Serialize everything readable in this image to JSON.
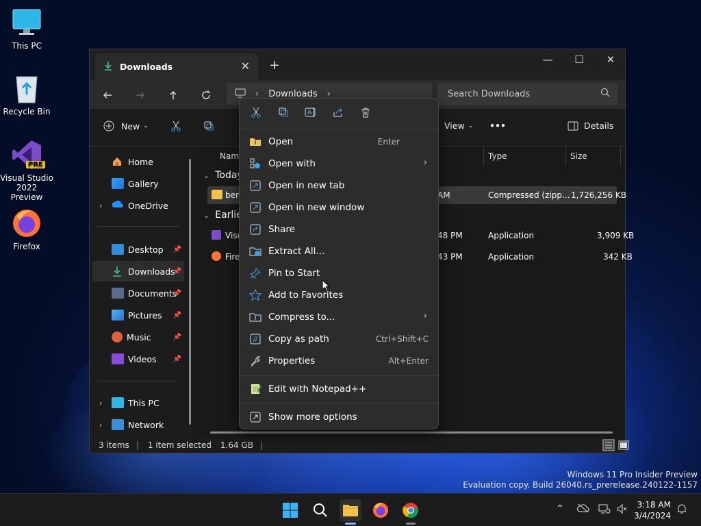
{
  "desktop": {
    "icons": [
      {
        "label": "This PC",
        "icon": "monitor-icon"
      },
      {
        "label": "Recycle Bin",
        "icon": "recycle-bin-icon"
      },
      {
        "label": "Visual Studio 2022 Preview",
        "icon": "visual-studio-icon",
        "badge": "PRE"
      },
      {
        "label": "Firefox",
        "icon": "firefox-icon"
      }
    ],
    "watermark": {
      "line1": "Windows 11 Pro Insider Preview",
      "line2": "Evaluation copy. Build 26040.rs_prerelease.240122-1157"
    }
  },
  "explorer": {
    "tab_title": "Downloads",
    "tab_close": "✕",
    "new_tab": "+",
    "window_controls": {
      "minimize": "—",
      "maximize": "☐",
      "close": "✕"
    },
    "address": {
      "crumb": "Downloads",
      "sep1": "›",
      "sep2": "›"
    },
    "search_placeholder": "Search Downloads",
    "command_bar": {
      "new": "New",
      "view": "View",
      "more": "•••",
      "details": "Details"
    },
    "sidebar": {
      "home": "Home",
      "gallery": "Gallery",
      "onedrive": "OneDrive",
      "desktop": "Desktop",
      "downloads": "Downloads",
      "documents": "Documents",
      "pictures": "Pictures",
      "music": "Music",
      "videos": "Videos",
      "this_pc": "This PC",
      "network": "Network"
    },
    "columns": {
      "name": "Name",
      "type": "Type",
      "size": "Size"
    },
    "groups": {
      "today": "Today",
      "earlier": "Earlier"
    },
    "rows": [
      {
        "name": "ben",
        "date": "AM",
        "type": "Compressed (zipp...",
        "size": "1,726,256 KB"
      },
      {
        "name": "Visu",
        "date": "48 PM",
        "type": "Application",
        "size": "3,909 KB"
      },
      {
        "name": "Firef",
        "date": "43 PM",
        "type": "Application",
        "size": "342 KB"
      }
    ],
    "status": {
      "items": "3 items",
      "selected": "1 item selected",
      "size": "1.64 GB",
      "bar": "|"
    }
  },
  "context_menu": {
    "quick_actions": [
      "cut-icon",
      "copy-icon",
      "rename-icon",
      "share-icon",
      "delete-icon"
    ],
    "items": [
      {
        "label": "Open",
        "accel": "Enter",
        "icon": "folder-zip-icon"
      },
      {
        "label": "Open with",
        "submenu": "›",
        "icon": "open-with-icon"
      },
      {
        "label": "Open in new tab",
        "icon": "new-tab-icon"
      },
      {
        "label": "Open in new window",
        "icon": "new-window-icon"
      },
      {
        "label": "Share",
        "icon": "share-icon"
      },
      {
        "label": "Extract All...",
        "icon": "extract-icon"
      },
      {
        "label": "Pin to Start",
        "icon": "pin-icon"
      },
      {
        "label": "Add to Favorites",
        "icon": "star-icon"
      },
      {
        "label": "Compress to...",
        "submenu": "›",
        "icon": "compress-icon"
      },
      {
        "label": "Copy as path",
        "accel": "Ctrl+Shift+C",
        "icon": "copy-path-icon"
      },
      {
        "label": "Properties",
        "accel": "Alt+Enter",
        "icon": "wrench-icon"
      },
      {
        "label": "Edit with Notepad++",
        "icon": "notepadpp-icon"
      },
      {
        "label": "Show more options",
        "icon": "more-options-icon"
      }
    ]
  },
  "taskbar": {
    "clock_time": "3:18 AM",
    "clock_date": "3/4/2024",
    "tray_chevron": "⌃"
  }
}
